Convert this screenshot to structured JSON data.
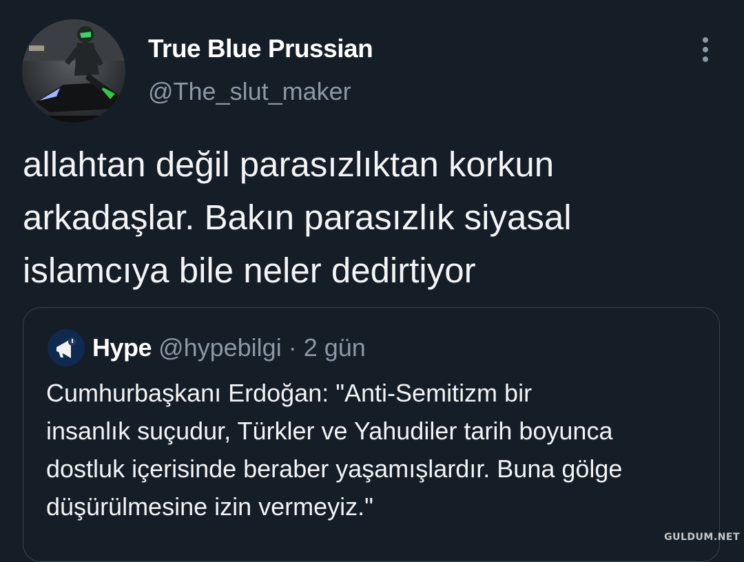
{
  "tweet": {
    "author_name": "True Blue Prussian",
    "author_handle": "@The_slut_maker",
    "more_icon": "more-vertical-icon",
    "text": "allahtan değil parasızlıktan korkun\narkadaşlar. Bakın parasızlık siyasal\nislamcıya bile neler dedirtiyor"
  },
  "quote": {
    "author_name": "Hype",
    "author_handle": "@hypebilgi",
    "separator": "·",
    "time": "2 gün",
    "text": "Cumhurbaşkanı Erdoğan: \"Anti-Semitizm bir\ninsanlık suçudur, Türkler ve Yahudiler tarih boyunca\ndostluk içerisinde beraber yaşamışlardır. Buna gölge\ndüşürülmesine izin vermeyiz.\""
  },
  "watermark": "GULDUM.NET",
  "colors": {
    "background": "#151d27",
    "text_primary": "#f2f4f5",
    "text_secondary": "#8b98a5",
    "border": "#38444d",
    "quote_avatar_bg": "#0f2a4f"
  }
}
